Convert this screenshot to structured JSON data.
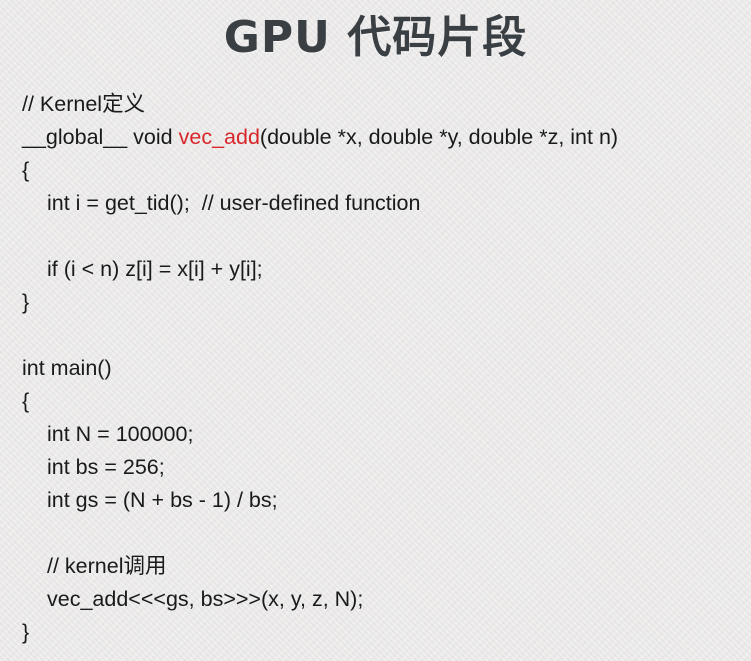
{
  "title": "GPU 代码片段",
  "accent_color": "#d8262b",
  "code": {
    "line1": "// Kernel定义",
    "line2_prefix": "__global__ void ",
    "line2_func": "vec_add",
    "line2_suffix": "(double *x, double *y, double *z, int n)",
    "line3": "{",
    "line4": "int i = get_tid();  // user-defined function",
    "line5": "",
    "line6": "if (i < n) z[i] = x[i] + y[i];",
    "line7": "}",
    "line8": "",
    "line9": "int main()",
    "line10": "{",
    "line11": "int N = 100000;",
    "line12": "int bs = 256;",
    "line13": "int gs = (N + bs - 1) / bs;",
    "line14": "",
    "line15": "// kernel调用",
    "line16": "vec_add<<<gs, bs>>>(x, y, z, N);",
    "line17": "}"
  }
}
